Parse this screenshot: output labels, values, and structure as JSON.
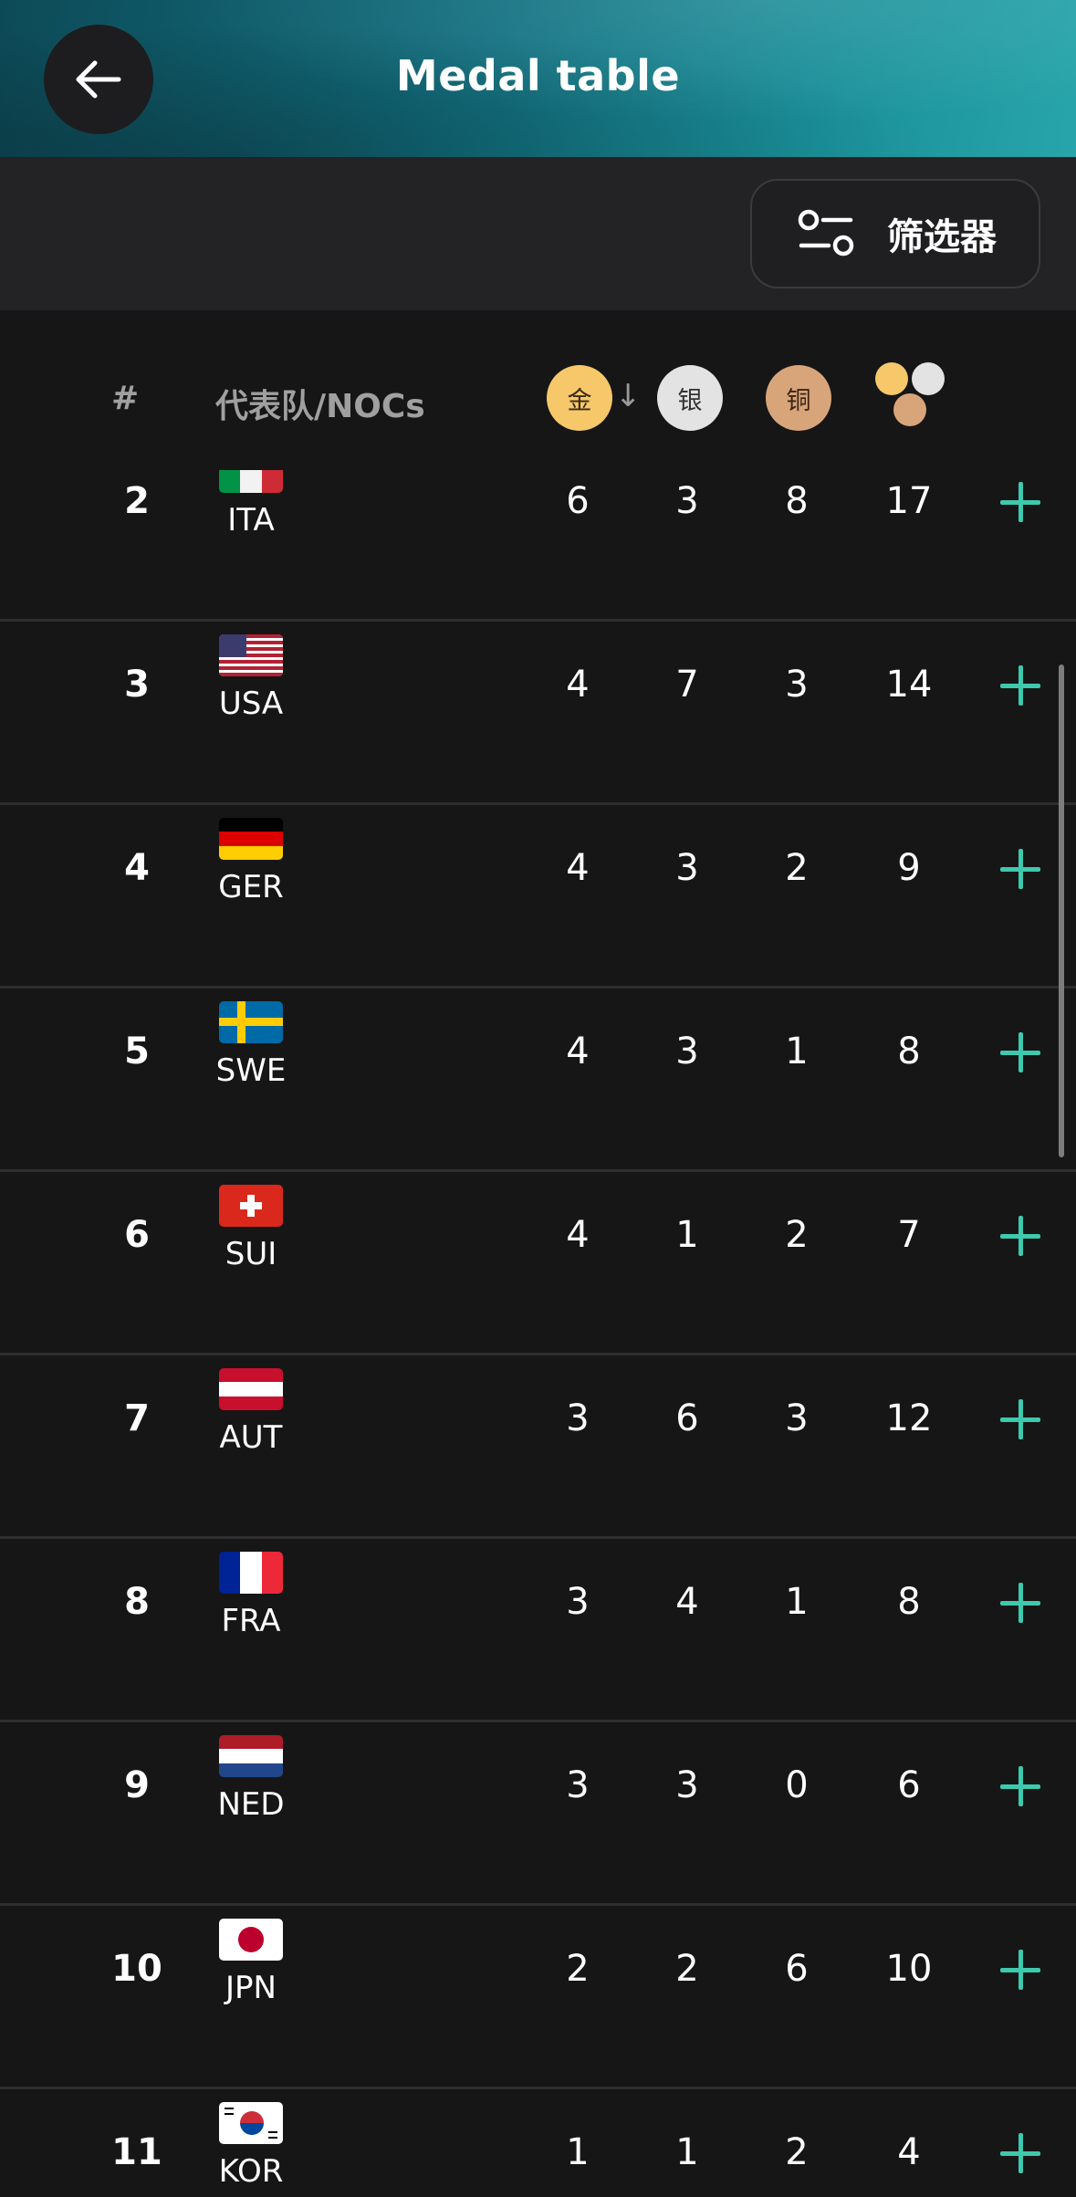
{
  "header": {
    "title": "Medal table",
    "back_icon": "arrow-left-icon"
  },
  "filter": {
    "label": "筛选器",
    "icon": "sliders-icon"
  },
  "columns": {
    "rank": "#",
    "team": "代表队/NOCs",
    "gold": "金",
    "silver": "银",
    "bronze": "铜",
    "sort_icon": "arrow-down-icon",
    "total_icon": "medals-total-icon"
  },
  "colors": {
    "gold": "#f6c86a",
    "silver": "#e3e3e3",
    "bronze": "#d8a57a",
    "accent": "#3ec9ae"
  },
  "rows": [
    {
      "rank": "2",
      "code": "ITA",
      "gold": "6",
      "silver": "3",
      "bronze": "8",
      "total": "17"
    },
    {
      "rank": "3",
      "code": "USA",
      "gold": "4",
      "silver": "7",
      "bronze": "3",
      "total": "14"
    },
    {
      "rank": "4",
      "code": "GER",
      "gold": "4",
      "silver": "3",
      "bronze": "2",
      "total": "9"
    },
    {
      "rank": "5",
      "code": "SWE",
      "gold": "4",
      "silver": "3",
      "bronze": "1",
      "total": "8"
    },
    {
      "rank": "6",
      "code": "SUI",
      "gold": "4",
      "silver": "1",
      "bronze": "2",
      "total": "7"
    },
    {
      "rank": "7",
      "code": "AUT",
      "gold": "3",
      "silver": "6",
      "bronze": "3",
      "total": "12"
    },
    {
      "rank": "8",
      "code": "FRA",
      "gold": "3",
      "silver": "4",
      "bronze": "1",
      "total": "8"
    },
    {
      "rank": "9",
      "code": "NED",
      "gold": "3",
      "silver": "3",
      "bronze": "0",
      "total": "6"
    },
    {
      "rank": "10",
      "code": "JPN",
      "gold": "2",
      "silver": "2",
      "bronze": "6",
      "total": "10"
    },
    {
      "rank": "11",
      "code": "KOR",
      "gold": "1",
      "silver": "1",
      "bronze": "2",
      "total": "4"
    }
  ]
}
